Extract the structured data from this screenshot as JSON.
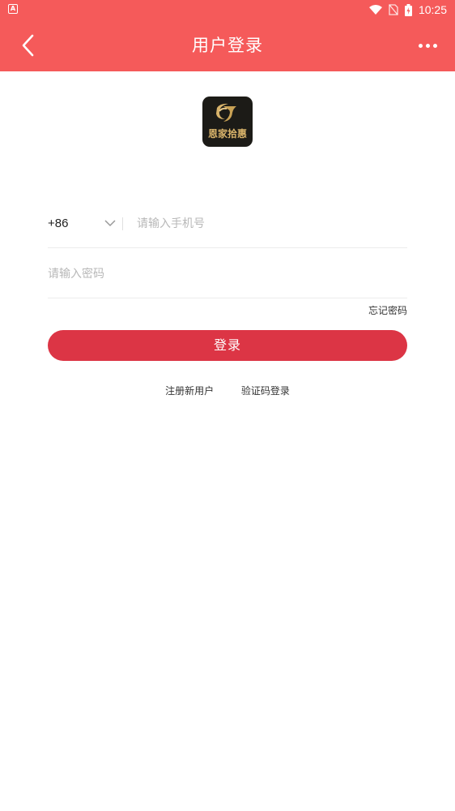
{
  "status_bar": {
    "app_badge": "A",
    "time": "10:25",
    "icons": [
      "wifi-icon",
      "no-sim-icon",
      "battery-icon"
    ]
  },
  "header": {
    "title": "用户登录",
    "back_icon": "chevron-left-icon",
    "more_icon": "more-horizontal-icon",
    "background": "#f55a5a"
  },
  "logo": {
    "text": "恩家拾惠",
    "background": "#1c1b17",
    "accent": "#d8b36a"
  },
  "form": {
    "country_code": "+86",
    "phone_placeholder": "请输入手机号",
    "phone_value": "",
    "password_placeholder": "请输入密码",
    "password_value": "",
    "forgot_label": "忘记密码",
    "login_label": "登录",
    "login_color": "#dc3545"
  },
  "links": {
    "register": "注册新用户",
    "sms_login": "验证码登录"
  }
}
